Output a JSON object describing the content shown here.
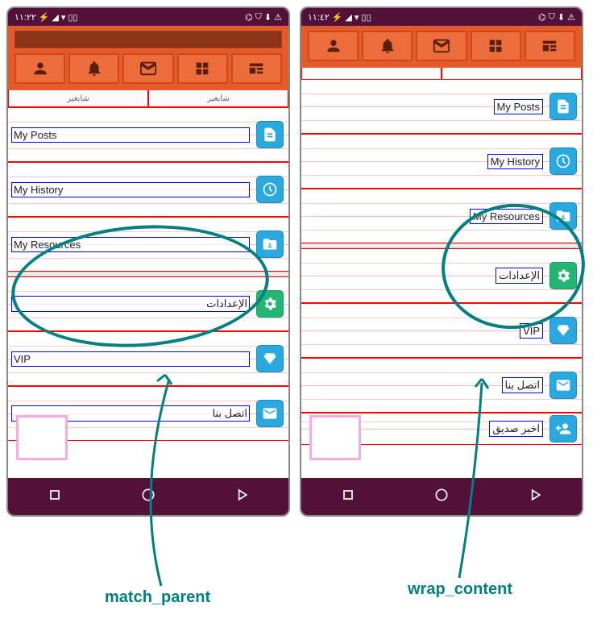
{
  "status_bar": {
    "left_time": "١١:٢٢",
    "right_time": "١١:٤٢",
    "icons": [
      "battery-icon",
      "signal-icon",
      "wifi-icon",
      "vibrate-icon",
      "bug-icon",
      "shield-icon",
      "download-icon",
      "warning-icon"
    ]
  },
  "tabs": {
    "t1": "profile-icon",
    "t2": "bell-icon",
    "t3": "inbox-icon",
    "t4": "grid-icon",
    "t5": "news-icon"
  },
  "sub_labels": {
    "left": "شابغير",
    "right": "شابغير"
  },
  "list": {
    "posts": {
      "label": "My Posts",
      "icon": "doc-icon"
    },
    "history": {
      "label": "My History",
      "icon": "clock-icon"
    },
    "resources": {
      "label": "My Resources",
      "icon": "folder-person-icon"
    },
    "settings": {
      "label": "الإعدادات",
      "icon": "gear-icon"
    },
    "vip": {
      "label": "VIP",
      "icon": "diamond-icon"
    },
    "contact": {
      "label": "اتصل بنا",
      "icon": "mail-icon"
    },
    "tell_friend": {
      "label": "اخبر صديق",
      "icon": "add-person-icon"
    }
  },
  "annotations": {
    "left_caption": "match_parent",
    "right_caption": "wrap_content"
  },
  "nav": {
    "recent": "recent-apps",
    "home": "home",
    "back": "back"
  }
}
